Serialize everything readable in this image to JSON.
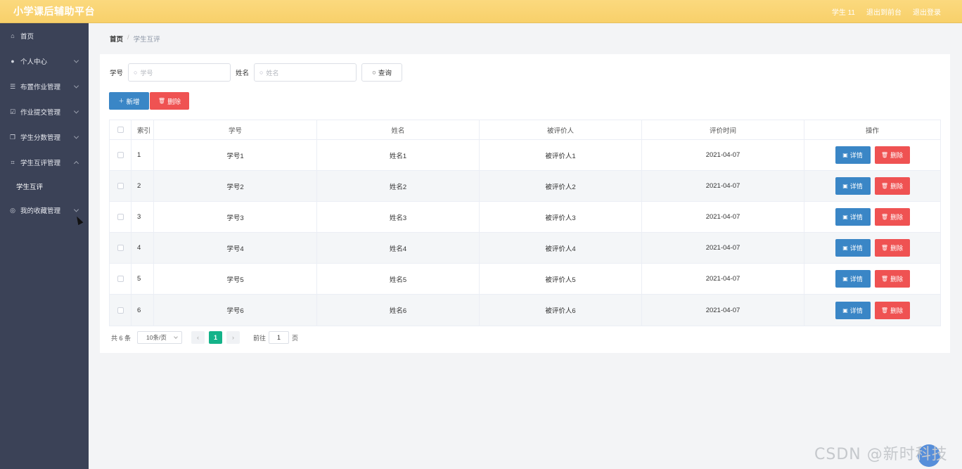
{
  "app": {
    "title": "小学课后辅助平台"
  },
  "topnav": {
    "user": "学生 11",
    "back_to_front": "退出到前台",
    "logout": "退出登录"
  },
  "sidebar": {
    "items": [
      {
        "label": "首页"
      },
      {
        "label": "个人中心"
      },
      {
        "label": "布置作业管理"
      },
      {
        "label": "作业提交管理"
      },
      {
        "label": "学生分数管理"
      },
      {
        "label": "学生互评管理"
      },
      {
        "label": "我的收藏管理"
      }
    ],
    "sub_items": [
      {
        "label": "学生互评"
      }
    ]
  },
  "breadcrumb": {
    "home": "首页",
    "separator": "/",
    "current": "学生互评"
  },
  "search": {
    "student_no_label": "学号",
    "student_no_placeholder": "学号",
    "name_label": "姓名",
    "name_placeholder": "姓名",
    "query_label": "查询"
  },
  "actions": {
    "add_label": "新增",
    "delete_label": "删除"
  },
  "table": {
    "headers": [
      "索引",
      "学号",
      "姓名",
      "被评价人",
      "评价时间",
      "操作"
    ],
    "rows": [
      {
        "index": "1",
        "student_no": "学号1",
        "name": "姓名1",
        "evaluatee": "被评价人1",
        "time": "2021-04-07"
      },
      {
        "index": "2",
        "student_no": "学号2",
        "name": "姓名2",
        "evaluatee": "被评价人2",
        "time": "2021-04-07"
      },
      {
        "index": "3",
        "student_no": "学号3",
        "name": "姓名3",
        "evaluatee": "被评价人3",
        "time": "2021-04-07"
      },
      {
        "index": "4",
        "student_no": "学号4",
        "name": "姓名4",
        "evaluatee": "被评价人4",
        "time": "2021-04-07"
      },
      {
        "index": "5",
        "student_no": "学号5",
        "name": "姓名5",
        "evaluatee": "被评价人5",
        "time": "2021-04-07"
      },
      {
        "index": "6",
        "student_no": "学号6",
        "name": "姓名6",
        "evaluatee": "被评价人6",
        "time": "2021-04-07"
      }
    ],
    "detail_label": "详情",
    "delete_label": "删除"
  },
  "pagination": {
    "total": "共 6 条",
    "page_size": "10条/页",
    "current_page": "1",
    "goto_label": "前往",
    "goto_value": "1",
    "page_suffix": "页"
  },
  "watermark": "CSDN @新时科技",
  "colors": {
    "topbar": "#f8d06a",
    "sidebar": "#3b4257",
    "primary": "#3a86c6",
    "danger": "#ef5252",
    "page_active": "#14b389"
  }
}
